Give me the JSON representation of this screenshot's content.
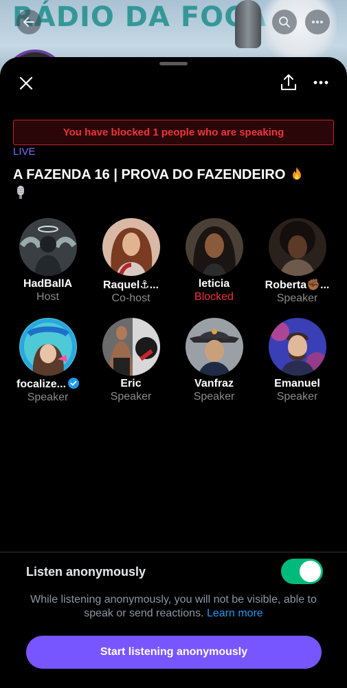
{
  "background": {
    "page_title": "RÁDIO DA FOCA"
  },
  "sheet": {
    "blocked_banner": "You have blocked 1 people who are speaking",
    "live_label": "LIVE",
    "title": "A FAZENDA 16 | PROVA DO FAZENDEIRO"
  },
  "participants": [
    {
      "name": "HadBallA",
      "role": "Host",
      "role_status": "normal"
    },
    {
      "name": "Raquel⚓...",
      "role": "Co-host",
      "role_status": "normal"
    },
    {
      "name": "leticia",
      "role": "Blocked",
      "role_status": "blocked"
    },
    {
      "name": "Roberta✊🏾...",
      "role": "Speaker",
      "role_status": "normal"
    },
    {
      "name": "focalize...",
      "role": "Speaker",
      "role_status": "normal",
      "verified": true
    },
    {
      "name": "Eric",
      "role": "Speaker",
      "role_status": "normal"
    },
    {
      "name": "Vanfraz",
      "role": "Speaker",
      "role_status": "normal"
    },
    {
      "name": "Emanuel",
      "role": "Speaker",
      "role_status": "normal"
    }
  ],
  "anonymous": {
    "label": "Listen anonymously",
    "toggle_on": true,
    "description": "While listening anonymously, you will not be visible, able to speak or send reactions.",
    "learn_more": "Learn more",
    "cta": "Start listening anonymously"
  },
  "colors": {
    "accent": "#7856ff",
    "live": "#7b6cf6",
    "blocked": "#f0333d",
    "toggle": "#00ba7c",
    "link": "#1d9bf0"
  },
  "icons": [
    "back-arrow-icon",
    "search-icon",
    "more-icon",
    "close-icon",
    "share-icon",
    "fire-icon",
    "microphone-icon",
    "verified-badge-icon"
  ]
}
